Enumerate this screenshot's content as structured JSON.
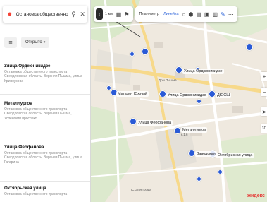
{
  "search": {
    "value": "Остановка общественного транспорта"
  },
  "filters": {
    "open_label": "Открыто"
  },
  "results": [
    {
      "title": "Улица Орджоникидзе",
      "sub": "Остановка общественного транспорта Свердловская область, Верхняя Пышма, улица Кривоусова"
    },
    {
      "title": "Металлургов",
      "sub": "Остановка общественного транспорта Свердловская область, Верхняя Пышма, Успенский проспект"
    },
    {
      "title": "Улица Феофанова",
      "sub": "Остановка общественного транспорта Свердловская область, Верхняя Пышма, улица Гагарина"
    },
    {
      "title": "Октябрьская улица",
      "sub": "Остановка общественного транспорта"
    }
  ],
  "map": {
    "toolbar": {
      "scale_label": "1 км",
      "planimeter": "Планиметр",
      "ruler": "Линейка"
    },
    "labels": [
      {
        "name": "stop-label-ordzhonikidze",
        "text": "Улица Орджоникидзе"
      },
      {
        "name": "stop-label-magazin",
        "text": "Магазин Южный"
      },
      {
        "name": "stop-label-ordzhonikidze-2",
        "text": "Улица Орджоникидзе"
      },
      {
        "name": "stop-label-dyussh",
        "text": "ДЮСШ"
      },
      {
        "name": "stop-label-feofanova",
        "text": "Улица Феофанова"
      },
      {
        "name": "stop-label-metallurgov",
        "text": "Металлургов"
      },
      {
        "name": "stop-label-metallurgov-sub",
        "text": "к.1,6"
      },
      {
        "name": "stop-label-zavodskaya",
        "text": "Заводская"
      },
      {
        "name": "stop-label-oktyabrskaya",
        "text": "Октябрьская улица"
      },
      {
        "name": "place-label-dom-kulturi",
        "text": "Дом Пышма"
      },
      {
        "name": "place-label-gorki",
        "text": "ПС Электрома"
      },
      {
        "name": "brand-label",
        "text": "Яндекс"
      }
    ],
    "colors": {
      "stop": "#2a5ad6",
      "accent": "#2a62d9"
    }
  }
}
